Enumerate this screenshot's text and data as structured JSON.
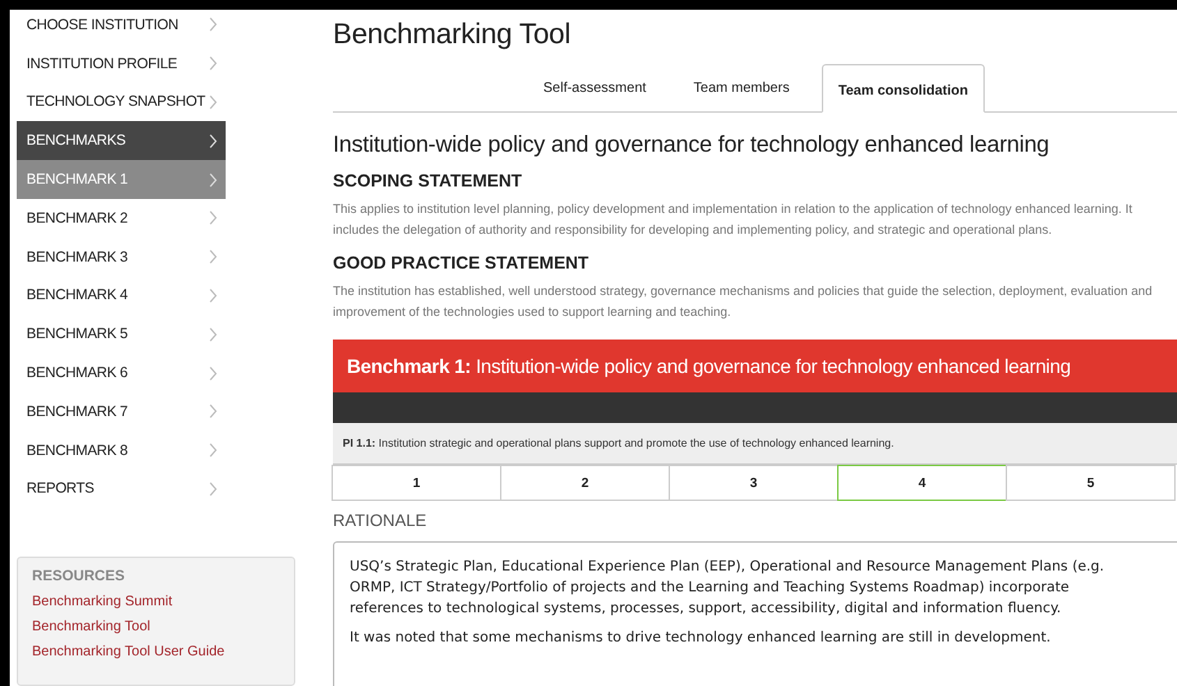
{
  "sidebar": {
    "items": [
      {
        "label": "CHOOSE INSTITUTION",
        "selected": false,
        "expanded": false
      },
      {
        "label": "INSTITUTION PROFILE",
        "selected": false,
        "expanded": false
      },
      {
        "label": "TECHNOLOGY SNAPSHOT",
        "selected": false,
        "expanded": false
      },
      {
        "label": "BENCHMARKS",
        "selected": false,
        "expanded": true
      },
      {
        "label": "BENCHMARK 1",
        "selected": true,
        "expanded": false
      },
      {
        "label": "BENCHMARK 2",
        "selected": false,
        "expanded": false
      },
      {
        "label": "BENCHMARK 3",
        "selected": false,
        "expanded": false
      },
      {
        "label": "BENCHMARK 4",
        "selected": false,
        "expanded": false
      },
      {
        "label": "BENCHMARK 5",
        "selected": false,
        "expanded": false
      },
      {
        "label": "BENCHMARK 6",
        "selected": false,
        "expanded": false
      },
      {
        "label": "BENCHMARK 7",
        "selected": false,
        "expanded": false
      },
      {
        "label": "BENCHMARK 8",
        "selected": false,
        "expanded": false
      },
      {
        "label": "REPORTS",
        "selected": false,
        "expanded": false
      }
    ],
    "resources": {
      "title": "RESOURCES",
      "links": [
        "Benchmarking Summit",
        "Benchmarking Tool",
        "Benchmarking Tool User Guide"
      ]
    }
  },
  "page_title": "Benchmarking Tool",
  "tabs": [
    {
      "label": "Self-assessment",
      "selected": false
    },
    {
      "label": "Team members",
      "selected": false
    },
    {
      "label": "Team consolidation",
      "selected": true
    }
  ],
  "heading": "Institution-wide policy and governance for technology enhanced learning",
  "sections": [
    {
      "title": "SCOPING STATEMENT",
      "text": "This applies to institution level planning, policy development and implementation in relation to the application of technology enhanced learning. It includes the delegation of authority and responsibility for developing and implementing policy, and strategic and operational plans."
    },
    {
      "title": "GOOD PRACTICE STATEMENT",
      "text": "The institution has established, well understood strategy, governance mechanisms and policies that guide the selection, deployment, evaluation and improvement of the technologies used to support learning and teaching."
    }
  ],
  "benchmark": {
    "title": "**Benchmark 1:** Institution-wide policy and governance for technology enhanced learning",
    "indicator": "**PI 1.1:** Institution strategic and operational plans support and promote the use of technology enhanced learning.",
    "ratings": [
      {
        "label": "1",
        "selected": false
      },
      {
        "label": "2",
        "selected": false
      },
      {
        "label": "3",
        "selected": false
      },
      {
        "label": "4",
        "selected": true
      },
      {
        "label": "5",
        "selected": false
      }
    ]
  },
  "rationale": {
    "label": "RATIONALE",
    "paragraphs": [
      "USQ’s Strategic Plan, Educational Experience Plan (EEP), Operational and Resource Management Plans (e.g. ORMP, ICT Strategy/Portfolio of projects and the Learning and Teaching Systems Roadmap) incorporate references to technological systems, processes, support, accessibility, digital and information fluency.",
      "It was noted that some mechanisms to drive technology enhanced learning are still in development."
    ]
  }
}
